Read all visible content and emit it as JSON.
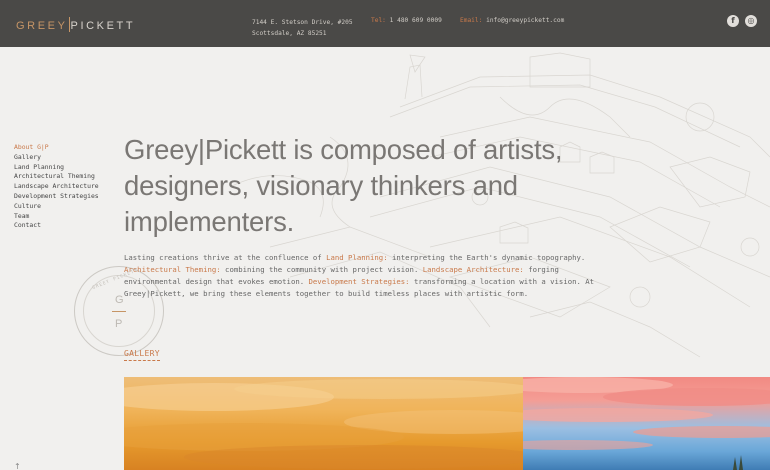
{
  "header": {
    "logo": {
      "part1": "GREEY",
      "part2": "PICKETT"
    },
    "address_line1": "7144 E. Stetson Drive, #205",
    "address_line2": "Scottsdale, AZ 85251",
    "tel_label": "Tel:",
    "tel_value": "1 480 609 0009",
    "email_label": "Email:",
    "email_value": "info@greeypickett.com",
    "social": [
      {
        "name": "facebook-icon",
        "glyph": "f"
      },
      {
        "name": "instagram-icon",
        "glyph": "◎"
      }
    ]
  },
  "sidenav": {
    "items": [
      {
        "label": "About G|P",
        "active": true
      },
      {
        "label": "Gallery"
      },
      {
        "label": "Land Planning"
      },
      {
        "label": "Architectural Theming"
      },
      {
        "label": "Landscape Architecture"
      },
      {
        "label": "Development Strategies"
      },
      {
        "label": "Culture"
      },
      {
        "label": "Team"
      },
      {
        "label": "Contact"
      }
    ]
  },
  "stamp": {
    "letter_top": "G",
    "letter_bottom": "P",
    "arc_text": "GREEY PICKETT"
  },
  "main": {
    "headline": "Greey|Pickett is composed of artists, designers, visionary thinkers and implementers.",
    "intro": {
      "t1": "Lasting creations thrive at the confluence of ",
      "h1": "Land Planning:",
      "t2": " interpreting the Earth's dynamic topography. ",
      "h2": "Architectural Theming:",
      "t3": " combining the community with project vision. ",
      "h3": "Landscape Architecture:",
      "t4": " forging environmental design that evokes emotion. ",
      "h4": "Development Strategies:",
      "t5": " transforming a location with a vision. At Greey|Pickett, we bring these elements together to build timeless places with artistic form."
    },
    "gallery_title": "GALLERY"
  },
  "colors": {
    "header_bg": "#4a4947",
    "accent": "#c9794a",
    "page_bg": "#f1f0ee"
  },
  "icons": {
    "scroll_top": "↑"
  }
}
